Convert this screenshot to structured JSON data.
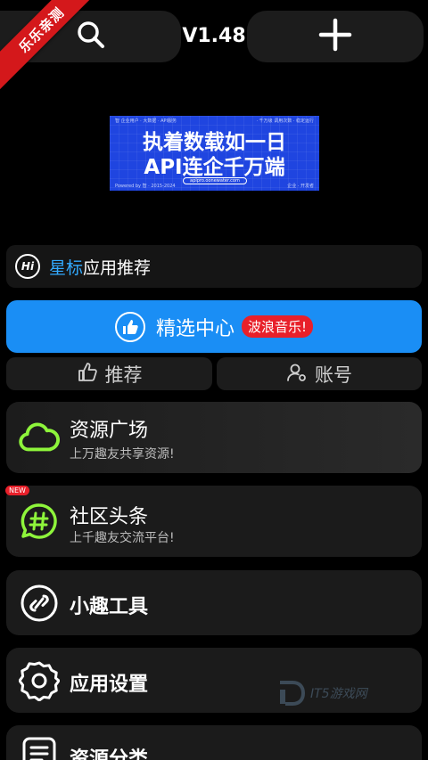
{
  "ribbon": {
    "text": "乐乐亲测"
  },
  "header": {
    "version": "V1.48",
    "search_icon": "search-icon",
    "add_icon": "plus-icon"
  },
  "banner": {
    "line1": "执着数载如一日",
    "line2": "API连企千万端",
    "url": "apipro.oonewater.com",
    "small_top_left": "智 企业用户 · 大数据 · API服务",
    "small_top_right": "· 千万级 调用次数 · 稳定运行",
    "small_bottom_left": "Powered by 智 · 2015-2024",
    "small_bottom_right": "企业 · 开发者"
  },
  "recommend_bar": {
    "highlight": "星标",
    "text": "应用推荐",
    "icon": "hi-chat-icon"
  },
  "select_center": {
    "label": "精选中心",
    "badge": "波浪音乐!",
    "icon": "thumbs-up-icon"
  },
  "tabs": [
    {
      "label": "推荐",
      "icon": "thumbs-up-outline-icon"
    },
    {
      "label": "账号",
      "icon": "user-gear-icon"
    }
  ],
  "cards": [
    {
      "title": "资源广场",
      "subtitle": "上万趣友共享资源!",
      "icon": "cloud-icon"
    },
    {
      "title": "社区头条",
      "subtitle": "上千趣友交流平台!",
      "icon": "hashtag-chat-icon",
      "badge": "NEW"
    },
    {
      "title": "小趣工具",
      "subtitle": "",
      "icon": "link-circle-icon"
    },
    {
      "title": "应用设置",
      "subtitle": "",
      "icon": "gear-icon"
    },
    {
      "title": "资源分类",
      "subtitle": "",
      "icon": "list-icon"
    }
  ],
  "watermark": {
    "text": "IT5游戏网"
  },
  "colors": {
    "accent": "#1a8ef5",
    "highlight": "#33aaff",
    "badge_red": "#e8202a",
    "cloud_green": "#8ef53b"
  }
}
